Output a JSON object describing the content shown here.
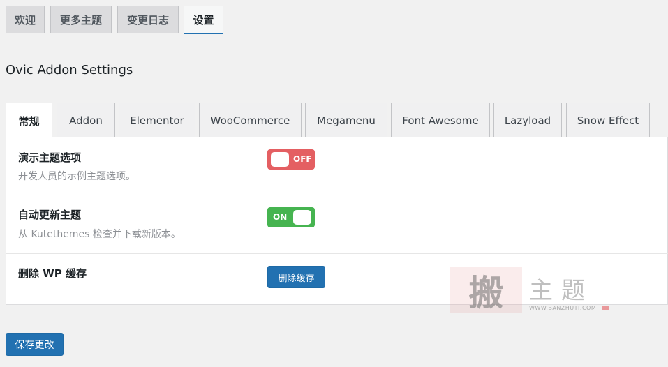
{
  "top_tabs": [
    {
      "label": "欢迎",
      "active": false
    },
    {
      "label": "更多主题",
      "active": false
    },
    {
      "label": "变更日志",
      "active": false
    },
    {
      "label": "设置",
      "active": true
    }
  ],
  "page_title": "Ovic Addon Settings",
  "sub_tabs": [
    {
      "label": "常规",
      "active": true
    },
    {
      "label": "Addon",
      "active": false
    },
    {
      "label": "Elementor",
      "active": false
    },
    {
      "label": "WooCommerce",
      "active": false
    },
    {
      "label": "Megamenu",
      "active": false
    },
    {
      "label": "Font Awesome",
      "active": false
    },
    {
      "label": "Lazyload",
      "active": false
    },
    {
      "label": "Snow Effect",
      "active": false
    }
  ],
  "settings": {
    "demo_options": {
      "title": "演示主题选项",
      "description": "开发人员的示例主题选项。",
      "toggle_state": "off",
      "toggle_label": "OFF"
    },
    "auto_update": {
      "title": "自动更新主题",
      "description": "从 Kutethemes 检查并下载新版本。",
      "toggle_state": "on",
      "toggle_label": "ON"
    },
    "delete_cache": {
      "title": "删除 WP 缓存",
      "button_label": "删除缓存"
    }
  },
  "save_button_label": "保存更改",
  "watermark": {
    "seal_text": "搬",
    "text": "主题",
    "url": "WWW.BANZHUTI.COM"
  },
  "colors": {
    "accent": "#2271b1",
    "toggle_off": "#e45f62",
    "toggle_on": "#46b450"
  }
}
